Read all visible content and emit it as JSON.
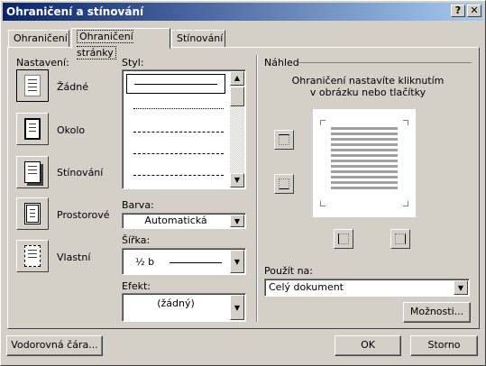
{
  "window": {
    "title": "Ohraničení a stínování",
    "help_button": "?",
    "close_button": "✕"
  },
  "tabs": [
    {
      "label": "Ohraničení"
    },
    {
      "label": "Ohraničení stránky"
    },
    {
      "label": "Stínování"
    }
  ],
  "settings": {
    "header": "Nastavení:",
    "items": [
      {
        "label": "Žádné",
        "icon": "border-none-icon"
      },
      {
        "label": "Okolo",
        "icon": "border-box-icon"
      },
      {
        "label": "Stínování",
        "icon": "border-shadow-icon"
      },
      {
        "label": "Prostorové",
        "icon": "border-3d-icon"
      },
      {
        "label": "Vlastní",
        "icon": "border-custom-icon"
      }
    ]
  },
  "style": {
    "header": "Styl:"
  },
  "color": {
    "label": "Barva:",
    "value": "Automatická"
  },
  "width": {
    "label": "Šířka:",
    "value": "½ b"
  },
  "effect": {
    "label": "Efekt:",
    "value": "(žádný)"
  },
  "preview": {
    "header": "Náhled",
    "hint_line1": "Ohraničení nastavíte kliknutím",
    "hint_line2": "v obrázku nebo tlačítky"
  },
  "apply_to": {
    "label": "Použít na:",
    "value": "Celý dokument"
  },
  "buttons": {
    "options": "Možnosti...",
    "horizontal_line": "Vodorovná čára...",
    "ok": "OK",
    "cancel": "Storno"
  }
}
